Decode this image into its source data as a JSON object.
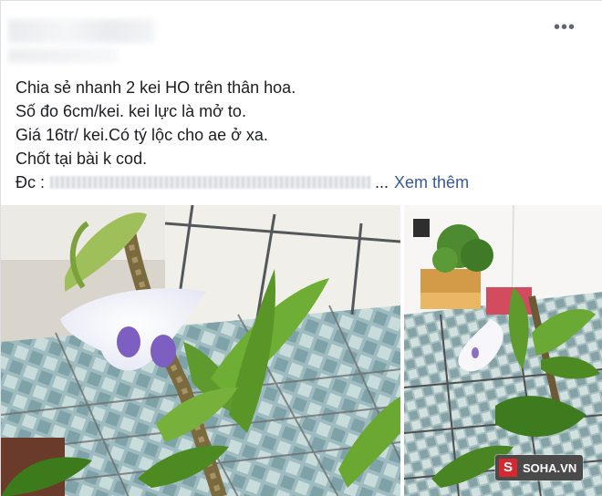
{
  "post": {
    "menu_icon": "more-horizontal-icon",
    "lines": [
      "Chia sẻ nhanh 2 kei HO trên thân hoa.",
      "Số đo 6cm/kei. kei lực là mở to.",
      "Giá 16tr/ kei.Có tý lộc cho ae ở xa.",
      "Chốt tại bài k cod."
    ],
    "address_label": "Đc :",
    "ellipsis": "...",
    "see_more": "Xem thêm"
  },
  "photos": {
    "count": 2,
    "watermark": {
      "logo_letter": "S",
      "text": "SOHA.VN"
    }
  },
  "colors": {
    "link": "#385898",
    "text": "#1c1e21",
    "watermark_red": "#d7282f"
  }
}
